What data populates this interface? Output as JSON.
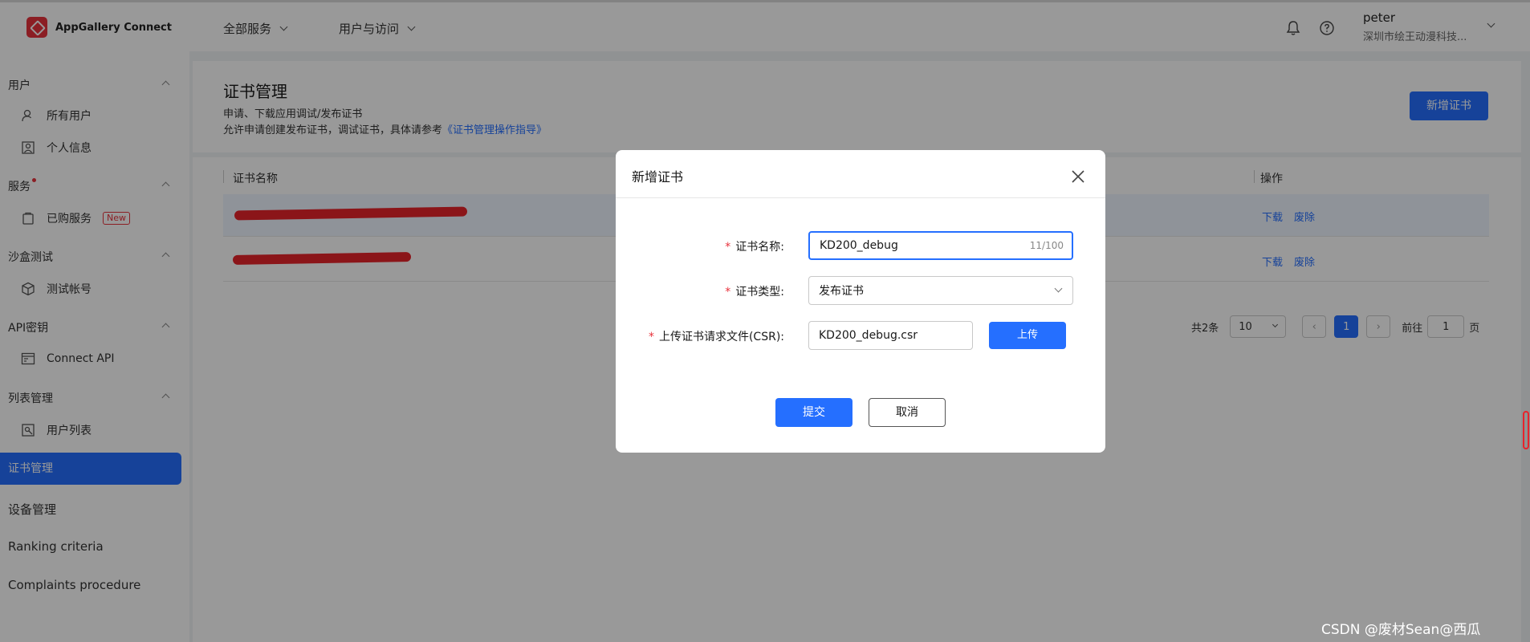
{
  "app": {
    "name": "AppGallery Connect"
  },
  "topnav": {
    "all_services": "全部服务",
    "users_access": "用户与访问"
  },
  "user": {
    "name": "peter",
    "org": "深圳市绘王动漫科技..."
  },
  "sidebar": {
    "sections": [
      {
        "label": "用户",
        "items": [
          "所有用户",
          "个人信息"
        ]
      },
      {
        "label": "服务",
        "items": [
          "已购服务"
        ],
        "badge": "New"
      },
      {
        "label": "沙盒测试",
        "items": [
          "测试帐号"
        ]
      },
      {
        "label": "API密钥",
        "items": [
          "Connect API"
        ]
      },
      {
        "label": "列表管理",
        "items": [
          "用户列表"
        ]
      }
    ],
    "active": "证书管理",
    "flat_items": [
      "设备管理",
      "Ranking criteria",
      "Complaints procedure"
    ]
  },
  "page": {
    "title": "证书管理",
    "subtitle": "申请、下载应用调试/发布证书",
    "desc_prefix": "允许申请创建发布证书，调试证书，具体请参考",
    "desc_link": "《证书管理操作指导》",
    "add_button": "新增证书"
  },
  "table": {
    "columns": {
      "name": "证书名称",
      "actions": "操作"
    },
    "row_actions": {
      "download": "下载",
      "revoke": "废除"
    },
    "pagination": {
      "total": "共2条",
      "page_size": "10",
      "current_page": "1",
      "goto_prefix": "前往",
      "goto_value": "1",
      "goto_suffix": "页"
    }
  },
  "dialog": {
    "title": "新增证书",
    "name_label": "证书名称:",
    "name_value": "KD200_debug",
    "name_counter": "11/100",
    "type_label": "证书类型:",
    "type_value": "发布证书",
    "csr_label": "上传证书请求文件(CSR):",
    "csr_value": "KD200_debug.csr",
    "upload_button": "上传",
    "submit_button": "提交",
    "cancel_button": "取消"
  },
  "watermark": "CSDN @废材Sean@西瓜",
  "colors": {
    "primary": "#256fff",
    "danger": "#e8323c"
  }
}
